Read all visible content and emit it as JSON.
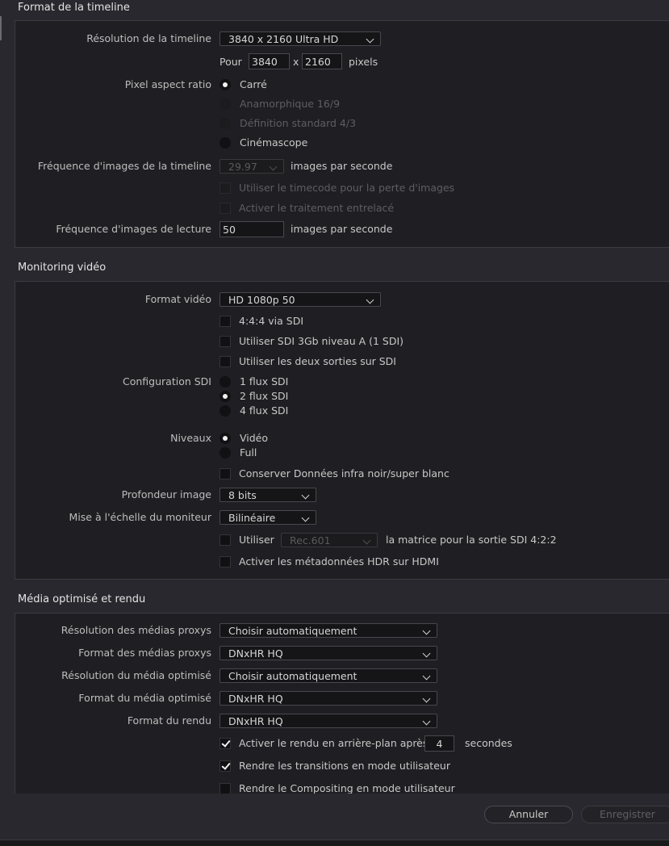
{
  "timeline": {
    "title": "Format de la timeline",
    "resolution_label": "Résolution de la timeline",
    "resolution_value": "3840 x 2160 Ultra HD",
    "pour_label": "Pour",
    "width": "3840",
    "x_label": "x",
    "height": "2160",
    "pixels_label": "pixels",
    "par_label": "Pixel aspect ratio",
    "par_options": [
      "Carré",
      "Anamorphique 16/9",
      "Définition standard 4/3",
      "Cinémascope"
    ],
    "fps_label": "Fréquence d'images de la timeline",
    "fps_value": "29.97",
    "fps_unit": "images par seconde",
    "dropframe_label": "Utiliser le timecode pour la perte d'images",
    "interlace_label": "Activer le traitement entrelacé",
    "playback_fps_label": "Fréquence d'images de lecture",
    "playback_fps_value": "50",
    "playback_fps_unit": "images par seconde"
  },
  "monitoring": {
    "title": "Monitoring vidéo",
    "format_label": "Format vidéo",
    "format_value": "HD 1080p 50",
    "opt_444": "4:4:4 via SDI",
    "opt_3gb": "Utiliser SDI 3Gb niveau A (1 SDI)",
    "opt_both": "Utiliser les deux sorties sur SDI",
    "sdi_label": "Configuration SDI",
    "sdi_options": [
      "1 flux SDI",
      "2 flux SDI",
      "4 flux SDI"
    ],
    "levels_label": "Niveaux",
    "levels_options": [
      "Vidéo",
      "Full"
    ],
    "keep_label": "Conserver Données infra noir/super blanc",
    "depth_label": "Profondeur image",
    "depth_value": "8 bits",
    "scale_label": "Mise à l'échelle du moniteur",
    "scale_value": "Bilinéaire",
    "use_label": "Utiliser",
    "matrix_value": "Rec.601",
    "matrix_suffix": "la matrice pour la sortie SDI 4:2:2",
    "hdr_label": "Activer les métadonnées HDR sur HDMI"
  },
  "media": {
    "title": "Média optimisé et rendu",
    "rows": [
      {
        "label": "Résolution des médias proxys",
        "value": "Choisir automatiquement"
      },
      {
        "label": "Format des médias proxys",
        "value": "DNxHR HQ"
      },
      {
        "label": "Résolution du média optimisé",
        "value": "Choisir automatiquement"
      },
      {
        "label": "Format du média optimisé",
        "value": "DNxHR HQ"
      },
      {
        "label": "Format du rendu",
        "value": "DNxHR HQ"
      }
    ],
    "bg_render_label": "Activer le rendu en arrière-plan après",
    "bg_render_value": "4",
    "bg_render_unit": "secondes",
    "transitions_label": "Rendre les transitions en mode utilisateur",
    "compositing_label": "Rendre le Compositing en mode utilisateur"
  },
  "footer": {
    "cancel": "Annuler",
    "save": "Enregistrer"
  },
  "colors": {
    "background": "#28282e",
    "panel": "#1f1f23",
    "text": "#c9c9c9",
    "disabled": "#5e5e62"
  }
}
